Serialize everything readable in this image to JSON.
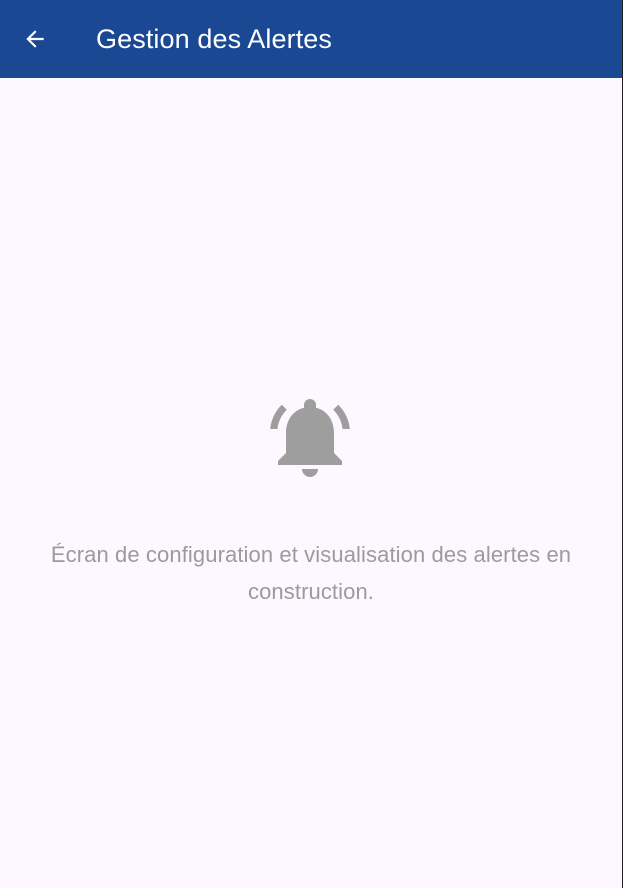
{
  "app_bar": {
    "title": "Gestion des Alertes",
    "back_icon": "arrow-left-icon",
    "background_color": "#1a4893",
    "text_color": "#ffffff"
  },
  "main": {
    "icon": "bell-ringing-icon",
    "icon_color": "#9e9e9e",
    "message": "Écran de configuration et visualisation des alertes en construction.",
    "message_color": "#9b9b9b",
    "background_color": "#fdf7ff"
  }
}
